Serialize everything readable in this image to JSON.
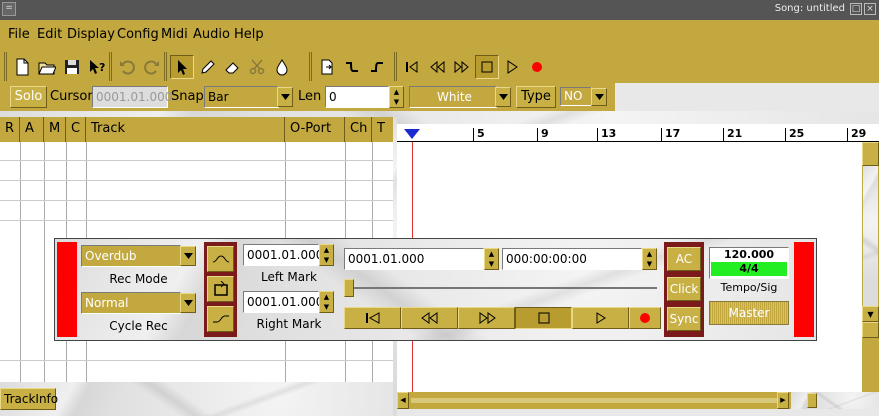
{
  "window": {
    "title": "Song: untitled",
    "menu_glyph": "=",
    "minimize_glyph": "□",
    "close_glyph": "×"
  },
  "menubar": {
    "items": [
      "File",
      "Edit",
      "Display",
      "Config",
      "Midi",
      "Audio",
      "Help"
    ]
  },
  "toolbar": {
    "file_tools": [
      "new-file-icon",
      "open-folder-icon",
      "save-disk-icon",
      "whats-this-icon"
    ],
    "undo_tools": [
      "undo-icon",
      "redo-icon"
    ],
    "edit_tools": [
      "pointer-icon",
      "pencil-icon",
      "eraser-icon",
      "scissors-icon",
      "glue-drop-icon"
    ],
    "panel_tools": [
      "panic-icon",
      "step-icon",
      "loop-icon"
    ],
    "transport_tools": [
      "rewind-to-start-icon",
      "rewind-icon",
      "forward-icon",
      "stop-icon",
      "play-icon",
      "record-icon"
    ]
  },
  "editbar": {
    "solo_label": "Solo",
    "cursor_label": "Cursor",
    "cursor_value": "0001.01.000",
    "snap_label": "Snap",
    "snap_value": "Bar",
    "len_label": "Len",
    "len_value": "0",
    "color_value": "White",
    "type_label": "Type",
    "type_value": "NO"
  },
  "tracklist": {
    "columns": [
      "R",
      "A",
      "M",
      "C",
      "Track",
      "O-Port",
      "Ch",
      "T"
    ]
  },
  "ruler": {
    "bars": [
      "5",
      "9",
      "13",
      "17",
      "21",
      "25",
      "29"
    ]
  },
  "trackinfo_label": "TrackInfo",
  "transport": {
    "rec_mode_value": "Overdub",
    "rec_mode_label": "Rec Mode",
    "cycle_rec_value": "Normal",
    "cycle_rec_label": "Cycle Rec",
    "left_mark_value": "0001.01.000",
    "left_mark_label": "Left Mark",
    "right_mark_value": "0001.01.000",
    "right_mark_label": "Right Mark",
    "position_bbt": "0001.01.000",
    "position_time": "000:00:00:00",
    "ac_label": "AC",
    "click_label": "Click",
    "sync_label": "Sync",
    "tempo_value": "120.000",
    "signature_value": "4/4",
    "tempo_sig_label": "Tempo/Sig",
    "master_label": "Master"
  },
  "colors": {
    "gold": "#c2a83e",
    "record_red": "#ff0000",
    "signature_green": "#22ee22",
    "maroon": "#7a1a1a"
  }
}
